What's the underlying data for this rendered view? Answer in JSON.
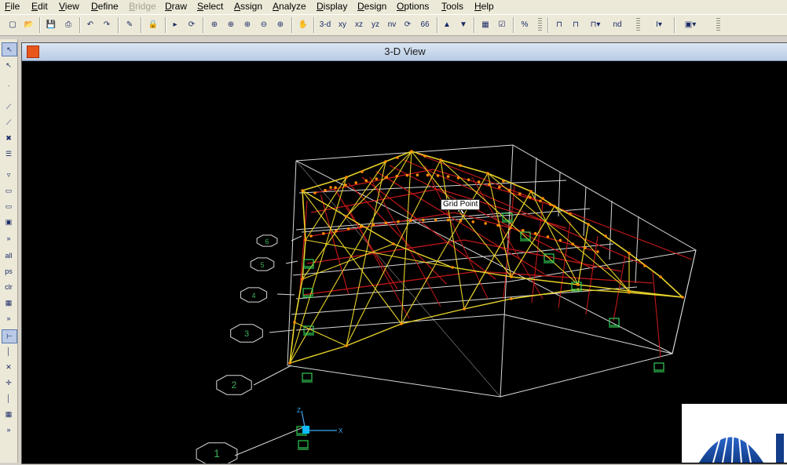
{
  "menus": [
    {
      "label": "File",
      "enabled": true
    },
    {
      "label": "Edit",
      "enabled": true
    },
    {
      "label": "View",
      "enabled": true
    },
    {
      "label": "Define",
      "enabled": true
    },
    {
      "label": "Bridge",
      "enabled": false
    },
    {
      "label": "Draw",
      "enabled": true
    },
    {
      "label": "Select",
      "enabled": true
    },
    {
      "label": "Assign",
      "enabled": true
    },
    {
      "label": "Analyze",
      "enabled": true
    },
    {
      "label": "Display",
      "enabled": true
    },
    {
      "label": "Design",
      "enabled": true
    },
    {
      "label": "Options",
      "enabled": true
    },
    {
      "label": "Tools",
      "enabled": true
    },
    {
      "label": "Help",
      "enabled": true
    }
  ],
  "toolbar": {
    "view_3d": "3-d",
    "view_xy": "xy",
    "view_xz": "xz",
    "view_yz": "yz",
    "view_nv": "nv",
    "view_66": "66",
    "view_nd": "nd"
  },
  "left_toolbar": {
    "all": "all",
    "ps": "ps",
    "clr": "clr"
  },
  "window": {
    "title": "3-D View"
  },
  "tooltip": {
    "text": "Grid Point"
  },
  "grid_bubbles": [
    "1",
    "2",
    "3",
    "4",
    "5",
    "6"
  ],
  "axis_labels": {
    "x": "X",
    "z": "Z"
  },
  "colors": {
    "background": "#000000",
    "grid": "#d8d8d8",
    "truss_chords": "#e8d22a",
    "red_members": "#c01818",
    "joints": "#ff8c00",
    "supports": "#33cc55",
    "bubbles": "#3fae5a"
  }
}
